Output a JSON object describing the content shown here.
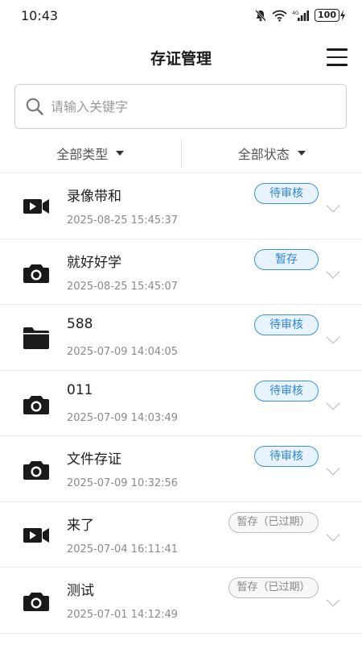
{
  "status_bar": {
    "time": "10:43",
    "battery": "100"
  },
  "header": {
    "title": "存证管理"
  },
  "search": {
    "placeholder": "请输入关键字"
  },
  "filters": {
    "type": "全部类型",
    "status": "全部状态"
  },
  "items": [
    {
      "icon": "video-camera-icon",
      "title": "录像带和",
      "time": "2025-08-25 15:45:37",
      "status": "待审核",
      "status_color": "blue"
    },
    {
      "icon": "camera-icon",
      "title": "就好好学",
      "time": "2025-08-25 15:45:07",
      "status": "暂存",
      "status_color": "blue"
    },
    {
      "icon": "folder-icon",
      "title": "588",
      "time": "2025-07-09 14:04:05",
      "status": "待审核",
      "status_color": "blue"
    },
    {
      "icon": "camera-icon",
      "title": "011",
      "time": "2025-07-09 14:03:49",
      "status": "待审核",
      "status_color": "blue"
    },
    {
      "icon": "camera-icon",
      "title": "文件存证",
      "time": "2025-07-09 10:32:56",
      "status": "待审核",
      "status_color": "blue"
    },
    {
      "icon": "video-camera-icon",
      "title": "来了",
      "time": "2025-07-04 16:11:41",
      "status": "暂存（已过期）",
      "status_color": "gray"
    },
    {
      "icon": "camera-icon",
      "title": "测试",
      "time": "2025-07-01 14:12:49",
      "status": "暂存（已过期）",
      "status_color": "gray"
    }
  ]
}
